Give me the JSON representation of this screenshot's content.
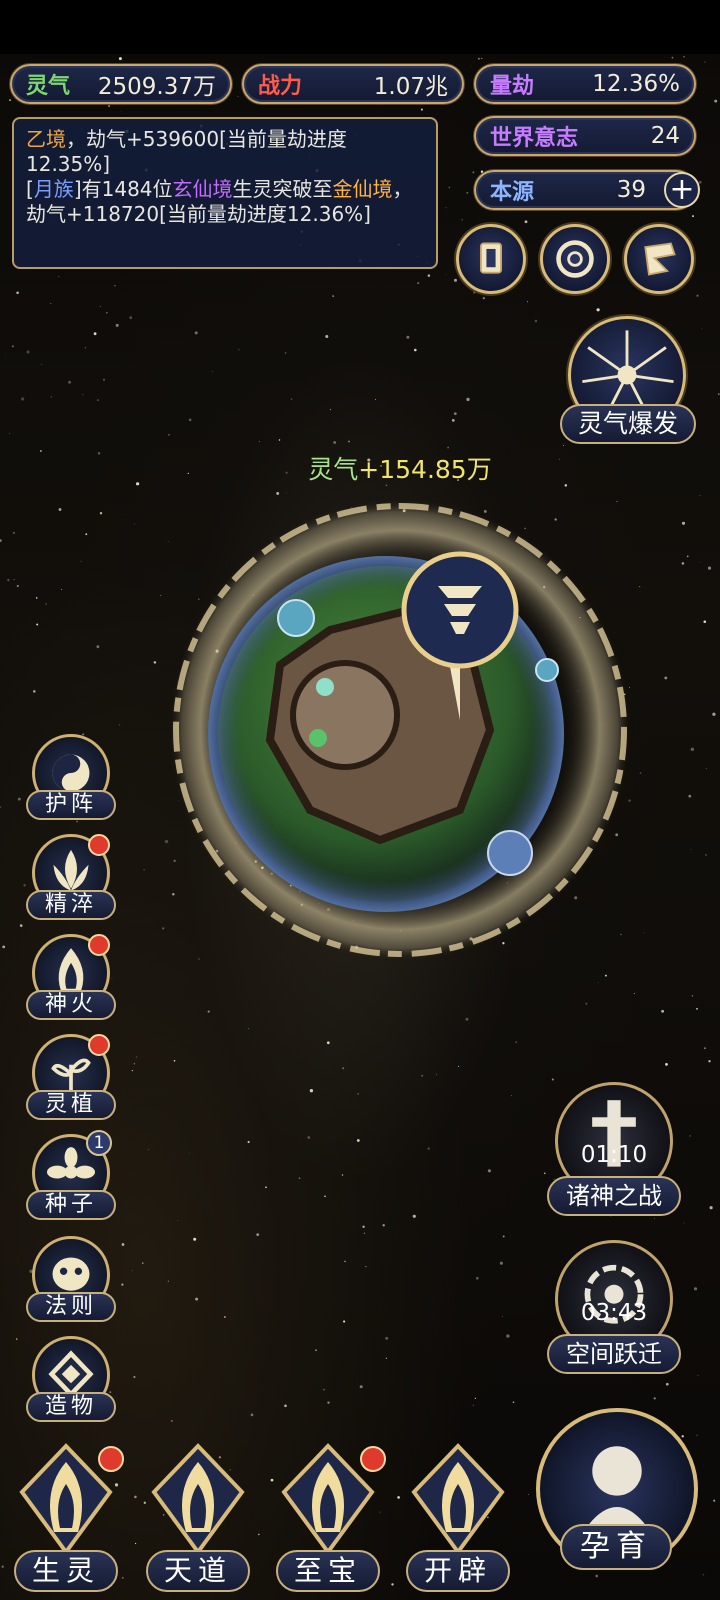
{
  "resources": {
    "lingqi": {
      "label": "灵气",
      "value": "2509.37万"
    },
    "zhanli": {
      "label": "战力",
      "value": "1.07兆"
    },
    "liangjie": {
      "label": "量劫",
      "value": "12.36%"
    },
    "world_will": {
      "label": "世界意志",
      "value": "24"
    },
    "origin": {
      "label": "本源",
      "value": "39",
      "plus": "+"
    }
  },
  "log": {
    "line1": {
      "realm": "乙境",
      "text": "，劫气+539600[当前量劫进度12.35%]"
    },
    "line2": {
      "open": "[",
      "tribe": "月族",
      "mid": "]有1484位",
      "realm_a": "玄仙境",
      "mid2": "生灵突破至",
      "realm_b": "金仙境",
      "text": "，劫气+118720[当前量劫进度12.36%]"
    }
  },
  "burst_button": {
    "label": "灵气爆发"
  },
  "gain_popup": {
    "label": "灵气",
    "value": "+154.85万"
  },
  "side_menu": [
    {
      "label": "护阵",
      "icon": "taiji-icon",
      "alert": false
    },
    {
      "label": "精淬",
      "icon": "lotus-flame-icon",
      "alert": true
    },
    {
      "label": "神火",
      "icon": "divine-fire-icon",
      "alert": true
    },
    {
      "label": "灵植",
      "icon": "spirit-plant-icon",
      "alert": true
    },
    {
      "label": "种子",
      "icon": "seed-flower-icon",
      "alert": false,
      "badge": "1"
    },
    {
      "label": "法则",
      "icon": "law-mask-icon",
      "alert": false
    },
    {
      "label": "造物",
      "icon": "creation-diamond-icon",
      "alert": false
    }
  ],
  "events": [
    {
      "label": "诸神之战",
      "timer": "01:10",
      "icon": "sword-icon"
    },
    {
      "label": "空间跃迁",
      "timer": "03:43",
      "icon": "vortex-icon"
    }
  ],
  "bottom_nav": [
    {
      "label": "生灵",
      "alert": true
    },
    {
      "label": "天道",
      "alert": false
    },
    {
      "label": "至宝",
      "alert": true
    },
    {
      "label": "开辟",
      "alert": false
    }
  ],
  "nurture_button": {
    "label": "孕育"
  },
  "colors": {
    "gold": "#c9a86a",
    "panel": "#1e2748",
    "alert": "#e03a2c"
  }
}
